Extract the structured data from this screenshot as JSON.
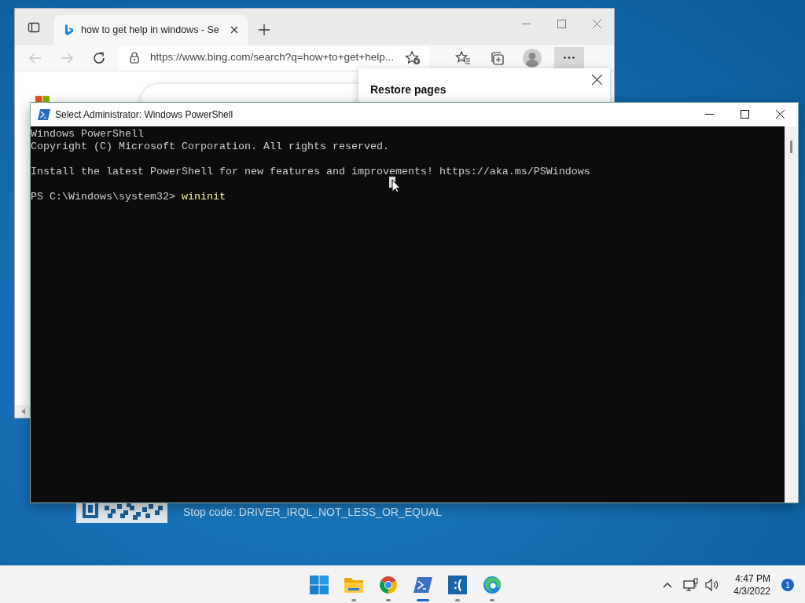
{
  "browser": {
    "tab": {
      "title": "how to get help in windows - Se",
      "selected": true
    },
    "address": "https://www.bing.com/search?q=how+to+get+help...",
    "popup": {
      "title": "Restore pages"
    }
  },
  "powershell": {
    "title": "Select Administrator: Windows PowerShell",
    "blocks": [
      {
        "lines": [
          "Windows PowerShell",
          "Copyright (C) Microsoft Corporation. All rights reserved."
        ]
      },
      {
        "lines": [
          "Install the latest PowerShell for new features and improvements! https://aka.ms/PSWindows"
        ]
      }
    ],
    "prompt": "PS C:\\Windows\\system32>",
    "command": "wininit"
  },
  "desktop": {
    "stop_code": "Stop code: DRIVER_IRQL_NOT_LESS_OR_EQUAL"
  },
  "taskbar": {
    "apps": [
      {
        "kind": "start",
        "active": false
      },
      {
        "kind": "folder",
        "active": false
      },
      {
        "kind": "chrome",
        "active": false
      },
      {
        "kind": "powershell",
        "active": true
      },
      {
        "kind": "sad",
        "label": ":(",
        "active": false
      },
      {
        "kind": "edge",
        "active": false
      }
    ],
    "time": "4:47 PM",
    "date": "4/3/2022",
    "notifications": "1"
  }
}
